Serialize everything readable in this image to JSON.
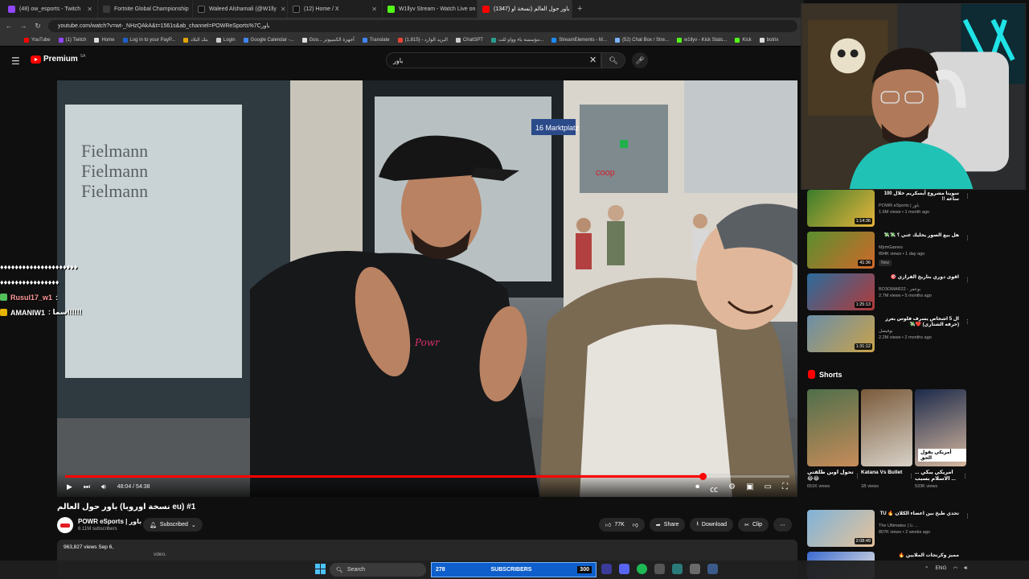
{
  "browser": {
    "tabs": [
      {
        "label": "(48) ow_esports - Twitch",
        "color": "#9146ff",
        "active": false
      },
      {
        "label": "Fortnite Global Championship",
        "color": "#3a3a3a",
        "active": false
      },
      {
        "label": "Waleed Alshamali (@W1lly",
        "color": "#111111",
        "active": false
      },
      {
        "label": "(12) Home / X",
        "color": "#111111",
        "active": false
      },
      {
        "label": "W1llyv Stream - Watch Live on",
        "color": "#53fc18",
        "active": false
      },
      {
        "label": "(1347) باور حول العالم (نسخة او",
        "color": "#ff0000",
        "active": true
      }
    ],
    "new_tab": "+",
    "url": "youtube.com/watch?v=wt-_NHzQAkA&t=1561s&ab_channel=POWReSports%7Cباور",
    "bookmarks": [
      {
        "label": "YouTube",
        "color": "#ff0000"
      },
      {
        "label": "(1) Twitch",
        "color": "#9146ff"
      },
      {
        "label": "Home",
        "color": "#dddddd"
      },
      {
        "label": "Log in to your PayP...",
        "color": "#1f5fc7"
      },
      {
        "label": "بنك البلاد",
        "color": "#e2a400"
      },
      {
        "label": "Login",
        "color": "#cccccc"
      },
      {
        "label": "Google Calendar -...",
        "color": "#4285f4"
      },
      {
        "label": "Goo... أجهزة الكمبيوتر",
        "color": "#dddddd"
      },
      {
        "label": "Translate",
        "color": "#4285f4"
      },
      {
        "label": "(1,815) - البريد الوارد",
        "color": "#ea4335"
      },
      {
        "label": "ChatGPT",
        "color": "#cccccc"
      },
      {
        "label": "مؤسسة باء وواو للت...",
        "color": "#2a9d8f"
      },
      {
        "label": "StreamElements - M...",
        "color": "#1b8cff"
      },
      {
        "label": "(52) Chat Box / Stre...",
        "color": "#7ab4ff"
      },
      {
        "label": "w1llyv - Kick Stats...",
        "color": "#53fc18"
      },
      {
        "label": "Kick",
        "color": "#53fc18"
      },
      {
        "label": "botrix",
        "color": "#dddddd"
      }
    ]
  },
  "youtube": {
    "logo_text": "Premium",
    "region": "SA",
    "search_value": "باور"
  },
  "player": {
    "time": "48:04 / 54:38",
    "progress_fraction": 0.88
  },
  "video": {
    "title": "#1 (eu نسخة اوروبا) باور حول العالم",
    "channel": "POWR eSports | باور",
    "subscribers": "6.11M subscribers",
    "subscribed_label": "Subscribed",
    "likes": "77K",
    "share": "Share",
    "download": "Download",
    "clip": "Clip",
    "views": "963,827 views  Sep 6,",
    "desc_more": "vdeo."
  },
  "recommendations": [
    {
      "title": "سوينا مشروع آيسكريم خلال 100 ساعة !!",
      "channel": "POWR eSports | باور",
      "views": "1.6M views • 1 month ago",
      "duration": "1:14:36",
      "badge": "",
      "c1": "#3a7d2c",
      "c2": "#e8b43a"
    },
    {
      "title": "هل بيع الصور يخليك غني ؟ 💸💸",
      "channel": "MjrmGames",
      "views": "894K views • 1 day ago",
      "duration": "41:36",
      "badge": "New",
      "c1": "#5a8f2e",
      "c2": "#d0682a"
    },
    {
      "title": "اقوى دوري بتاريخ الفرازي 🎯",
      "channel": "BO3OMAR22 - بوعمر",
      "views": "2.7M views • 5 months ago",
      "duration": "1:25:13",
      "badge": "",
      "c1": "#2b6c9c",
      "c2": "#b23a3a"
    },
    {
      "title": "ال 5 اشخاص يسرف فلوس بغرز (حرفه الشتاري) ❤️💸",
      "channel": "بوفيصل",
      "views": "2.2M views • 2 months ago",
      "duration": "1:31:12",
      "badge": "",
      "c1": "#6b8fa8",
      "c2": "#c9a24a"
    }
  ],
  "shorts": {
    "heading": "Shorts",
    "items": [
      {
        "title": "تحول اوبن طلقتي 😂😂",
        "views": "651K views",
        "c1": "#4f6f4b",
        "c2": "#c78c5a"
      },
      {
        "title": "Katana Vs Bullet",
        "views": "1B views",
        "c1": "#7a5a3a",
        "c2": "#d8d2c8"
      },
      {
        "title": "أمريكي يبكي ... الاسلام بسبب ...",
        "views": "533K views",
        "c1": "#1c2a4a",
        "c2": "#d6b8a0"
      }
    ],
    "short3_overlay": "أمريكي يقول الحق"
  },
  "rec5": {
    "title": "تحدي طبخ بين اعضاء الكلان 🔥 TU",
    "channel": "The Ultimates | ذا ...",
    "views": "807K views • 2 weeks ago",
    "duration": "2:08:49"
  },
  "rec6": {
    "title": "مميز وكرنجات الملايين 🔥"
  },
  "chat": [
    {
      "user": "Rusul17_w1",
      "msg": ":",
      "badge": "#53c15a"
    },
    {
      "user": "AMANIW1",
      "msg": ": سما!!!!!!",
      "badge": "#e6b400"
    }
  ],
  "chat_spam": "♦♦♦♦♦♦♦♦♦♦♦♦♦♦♦♦♦♦♦♦♦",
  "chat_spam2": "♦♦♦♦♦♦♦♦♦♦♦♦♦♦♦♦",
  "taskbar": {
    "search": "Search",
    "sub_count": "278",
    "sub_label": "SUBSCRIBERS",
    "sub_goal": "300",
    "lang": "ENG"
  }
}
